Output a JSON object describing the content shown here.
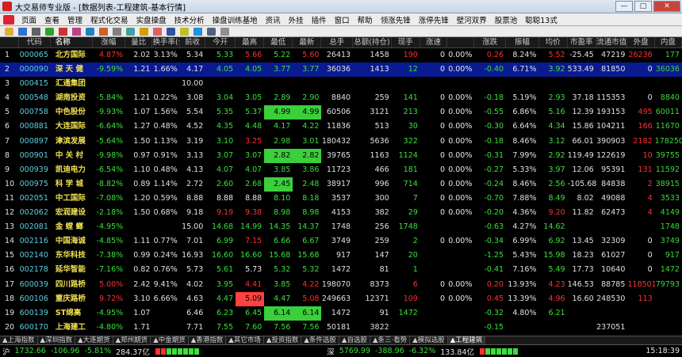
{
  "window": {
    "title": "大交易师专业版 - [数据列表-工程建筑-基本行情]",
    "minimize": "—",
    "maximize": "□",
    "close": "✕"
  },
  "menu": [
    "页面",
    "查看",
    "管理",
    "程式化交易",
    "实盘操盘",
    "技术分析",
    "操盘训练基地",
    "资讯",
    "外挂",
    "插件",
    "窗口",
    "帮助",
    "领涨先锋",
    "涨停先锋",
    "壁河双界",
    "股票池",
    "聪聪13式"
  ],
  "toolbar_icons": [
    "folder-icon",
    "save-icon",
    "print-icon",
    "arrow-up-icon",
    "arrow-down-icon",
    "chart-icon",
    "list-icon",
    "candle-icon",
    "zoom-icon",
    "grid-icon",
    "diamond-icon",
    "star-icon",
    "flag-icon",
    "bell-icon",
    "info-icon",
    "table-icon",
    "tool-icon"
  ],
  "headers": [
    "",
    "代码",
    "名称",
    "涨幅",
    "量比",
    "换手率(仓差)",
    "前收",
    "今开",
    "最高",
    "最低",
    "最新",
    "总手",
    "总额(持仓)",
    "现手",
    "涨速",
    "涨跌",
    "振幅",
    "均价",
    "市盈率",
    "流通市值",
    "外盘",
    "内盘"
  ],
  "rows": [
    {
      "idx": "1",
      "code": "000065",
      "name": "北方国际",
      "pct": "4.87%",
      "liang": "2.02",
      "hsl": "3.13%",
      "prev": "5.34",
      "open": "5.33",
      "high": "5.66",
      "low": "5.22",
      "last": "5.60",
      "total": "26413",
      "hold": "1458",
      "cur": "190",
      "zs": "0",
      "zf": "0.00%",
      "zd": "0.26",
      "zf2": "8.24%",
      "avg": "5.52",
      "pe": "-25.45",
      "flow": "47219",
      "out": "26236",
      "in": "177"
    },
    {
      "idx": "2",
      "code": "000090",
      "name": "深 天 健",
      "pct": "-9.59%",
      "liang": "1.21",
      "hsl": "1.66%",
      "prev": "4.17",
      "open": "4.05",
      "high": "4.05",
      "low": "3.77",
      "last": "3.77",
      "total": "36036",
      "hold": "1413",
      "cur": "12",
      "zs": "0",
      "zf": "0.00%",
      "zd": "-0.40",
      "zf2": "6.71%",
      "avg": "3.92",
      "pe": "533.49",
      "flow": "81850",
      "out": "0",
      "in": "36036"
    },
    {
      "idx": "3",
      "code": "000415",
      "name": "汇通集团",
      "pct": "",
      "liang": "",
      "hsl": "",
      "prev": "10.00",
      "open": "",
      "high": "",
      "low": "",
      "last": "",
      "total": "",
      "hold": "",
      "cur": "",
      "zs": "",
      "zf": "",
      "zd": "",
      "zf2": "",
      "avg": "",
      "pe": "",
      "flow": "",
      "out": "",
      "in": ""
    },
    {
      "idx": "4",
      "code": "000548",
      "name": "湖南投资",
      "pct": "-5.84%",
      "liang": "1.21",
      "hsl": "0.22%",
      "prev": "3.08",
      "open": "3.04",
      "high": "3.05",
      "low": "2.89",
      "last": "2.90",
      "total": "8840",
      "hold": "259",
      "cur": "141",
      "zs": "0",
      "zf": "0.00%",
      "zd": "-0.18",
      "zf2": "5.19%",
      "avg": "2.93",
      "pe": "37.18",
      "flow": "115353",
      "out": "0",
      "in": "8840"
    },
    {
      "idx": "5",
      "code": "000758",
      "name": "中色股份",
      "pct": "-9.93%",
      "liang": "1.07",
      "hsl": "1.56%",
      "prev": "5.54",
      "open": "5.35",
      "high": "5.37",
      "low": "4.99",
      "last": "4.99",
      "total": "60506",
      "hold": "3121",
      "cur": "213",
      "zs": "0",
      "zf": "0.00%",
      "zd": "-0.55",
      "zf2": "6.86%",
      "avg": "5.16",
      "pe": "12.39",
      "flow": "193153",
      "out": "495",
      "in": "60011"
    },
    {
      "idx": "6",
      "code": "000881",
      "name": "大连国际",
      "pct": "-6.64%",
      "liang": "1.27",
      "hsl": "0.48%",
      "prev": "4.52",
      "open": "4.35",
      "high": "4.48",
      "low": "4.17",
      "last": "4.22",
      "total": "11836",
      "hold": "513",
      "cur": "30",
      "zs": "0",
      "zf": "0.00%",
      "zd": "-0.30",
      "zf2": "6.64%",
      "avg": "4.34",
      "pe": "15.86",
      "flow": "104211",
      "out": "166",
      "in": "11670"
    },
    {
      "idx": "7",
      "code": "000897",
      "name": "津滨发展",
      "pct": "-5.64%",
      "liang": "1.50",
      "hsl": "1.13%",
      "prev": "3.19",
      "open": "3.10",
      "high": "3.25",
      "low": "2.98",
      "last": "3.01",
      "total": "180432",
      "hold": "5636",
      "cur": "322",
      "zs": "0",
      "zf": "0.00%",
      "zd": "-0.18",
      "zf2": "8.46%",
      "avg": "3.12",
      "pe": "66.01",
      "flow": "390903",
      "out": "2182",
      "in": "178250"
    },
    {
      "idx": "8",
      "code": "000901",
      "name": "中 关 村",
      "pct": "-9.98%",
      "liang": "0.97",
      "hsl": "0.91%",
      "prev": "3.13",
      "open": "3.07",
      "high": "3.07",
      "low": "2.82",
      "last": "2.82",
      "total": "39765",
      "hold": "1163",
      "cur": "1124",
      "zs": "0",
      "zf": "0.00%",
      "zd": "-0.31",
      "zf2": "7.99%",
      "avg": "2.92",
      "pe": "119.49",
      "flow": "122619",
      "out": "10",
      "in": "39755"
    },
    {
      "idx": "9",
      "code": "000939",
      "name": "凯迪电力",
      "pct": "-6.54%",
      "liang": "1.10",
      "hsl": "0.48%",
      "prev": "4.13",
      "open": "4.07",
      "high": "4.07",
      "low": "3.85",
      "last": "3.86",
      "total": "11723",
      "hold": "466",
      "cur": "181",
      "zs": "0",
      "zf": "0.00%",
      "zd": "-0.27",
      "zf2": "5.33%",
      "avg": "3.97",
      "pe": "12.06",
      "flow": "95391",
      "out": "131",
      "in": "11592"
    },
    {
      "idx": "10",
      "code": "000975",
      "name": "科 学 城",
      "pct": "-8.82%",
      "liang": "0.89",
      "hsl": "1.14%",
      "prev": "2.72",
      "open": "2.60",
      "high": "2.68",
      "low": "2.45",
      "last": "2.48",
      "total": "38917",
      "hold": "996",
      "cur": "714",
      "zs": "0",
      "zf": "0.00%",
      "zd": "-0.24",
      "zf2": "8.46%",
      "avg": "2.56",
      "pe": "-105.68",
      "flow": "84838",
      "out": "2",
      "in": "38915"
    },
    {
      "idx": "11",
      "code": "002051",
      "name": "中工国际",
      "pct": "-7.08%",
      "liang": "1.20",
      "hsl": "0.59%",
      "prev": "8.88",
      "open": "8.88",
      "high": "8.88",
      "low": "8.10",
      "last": "8.18",
      "total": "3537",
      "hold": "300",
      "cur": "7",
      "zs": "0",
      "zf": "0.00%",
      "zd": "-0.70",
      "zf2": "7.88%",
      "avg": "8.49",
      "pe": "8.02",
      "flow": "49088",
      "out": "4",
      "in": "3533"
    },
    {
      "idx": "12",
      "code": "002062",
      "name": "宏润建设",
      "pct": "-2.18%",
      "liang": "1.50",
      "hsl": "0.68%",
      "prev": "9.18",
      "open": "9.19",
      "high": "9.38",
      "low": "8.98",
      "last": "8.98",
      "total": "4153",
      "hold": "382",
      "cur": "29",
      "zs": "0",
      "zf": "0.00%",
      "zd": "-0.20",
      "zf2": "4.36%",
      "avg": "9.20",
      "pe": "11.82",
      "flow": "62473",
      "out": "4",
      "in": "4149"
    },
    {
      "idx": "13",
      "code": "002081",
      "name": "金 螳 螂",
      "pct": "-4.95%",
      "liang": "",
      "hsl": "",
      "prev": "15.00",
      "open": "14.68",
      "high": "14.99",
      "low": "14.35",
      "last": "14.37",
      "total": "1748",
      "hold": "256",
      "cur": "1748",
      "zs": "",
      "zf": "",
      "zd": "-0.63",
      "zf2": "4.27%",
      "avg": "14.62",
      "pe": "",
      "flow": "",
      "out": "",
      "in": "1748"
    },
    {
      "idx": "14",
      "code": "002116",
      "name": "中国海诚",
      "pct": "-4.85%",
      "liang": "1.11",
      "hsl": "0.77%",
      "prev": "7.01",
      "open": "6.99",
      "high": "7.15",
      "low": "6.66",
      "last": "6.67",
      "total": "3749",
      "hold": "259",
      "cur": "2",
      "zs": "0",
      "zf": "0.00%",
      "zd": "-0.34",
      "zf2": "6.99%",
      "avg": "6.92",
      "pe": "13.45",
      "flow": "32309",
      "out": "0",
      "in": "3749"
    },
    {
      "idx": "15",
      "code": "002140",
      "name": "东华科技",
      "pct": "-7.38%",
      "liang": "0.99",
      "hsl": "0.24%",
      "prev": "16.93",
      "open": "16.60",
      "high": "16.60",
      "low": "15.68",
      "last": "15.68",
      "total": "917",
      "hold": "147",
      "cur": "20",
      "zs": "",
      "zf": "",
      "zd": "-1.25",
      "zf2": "5.43%",
      "avg": "15.98",
      "pe": "18.23",
      "flow": "61027",
      "out": "0",
      "in": "917"
    },
    {
      "idx": "16",
      "code": "002178",
      "name": "延华智能",
      "pct": "-7.16%",
      "liang": "0.82",
      "hsl": "0.76%",
      "prev": "5.73",
      "open": "5.61",
      "high": "5.73",
      "low": "5.32",
      "last": "5.32",
      "total": "1472",
      "hold": "81",
      "cur": "1",
      "zs": "",
      "zf": "",
      "zd": "-0.41",
      "zf2": "7.16%",
      "avg": "5.49",
      "pe": "17.73",
      "flow": "10640",
      "out": "0",
      "in": "1472"
    },
    {
      "idx": "17",
      "code": "600039",
      "name": "四川路桥",
      "pct": "5.00%",
      "liang": "2.42",
      "hsl": "9.41%",
      "prev": "4.02",
      "open": "3.95",
      "high": "4.41",
      "low": "3.85",
      "last": "4.22",
      "total": "198070",
      "hold": "8373",
      "cur": "6",
      "zs": "0",
      "zf": "0.00%",
      "zd": "0.20",
      "zf2": "13.93%",
      "avg": "4.23",
      "pe": "146.53",
      "flow": "88785",
      "out": "118501",
      "in": "79793"
    },
    {
      "idx": "18",
      "code": "600106",
      "name": "重庆路桥",
      "pct": "9.72%",
      "liang": "3.10",
      "hsl": "6.66%",
      "prev": "4.63",
      "open": "4.47",
      "high": "5.09",
      "low": "4.47",
      "last": "5.08",
      "total": "249663",
      "hold": "12371",
      "cur": "109",
      "zs": "0",
      "zf": "0.00%",
      "zd": "0.45",
      "zf2": "13.39%",
      "avg": "4.96",
      "pe": "16.60",
      "flow": "248530",
      "out": "113",
      "in": ""
    },
    {
      "idx": "19",
      "code": "600139",
      "name": "ST绵高",
      "pct": "-4.95%",
      "liang": "1.07",
      "hsl": "",
      "prev": "6.46",
      "open": "6.23",
      "high": "6.45",
      "low": "6.14",
      "last": "6.14",
      "total": "1472",
      "hold": "91",
      "cur": "1472",
      "zs": "",
      "zf": "",
      "zd": "-0.32",
      "zf2": "4.80%",
      "avg": "6.21",
      "pe": "",
      "flow": "",
      "out": "",
      "in": ""
    },
    {
      "idx": "20",
      "code": "600170",
      "name": "上海建工",
      "pct": "-4.80%",
      "liang": "1.71",
      "hsl": "",
      "prev": "7.71",
      "open": "7.55",
      "high": "7.60",
      "low": "7.56",
      "last": "7.56",
      "total": "50181",
      "hold": "3822",
      "cur": "",
      "zs": "",
      "zf": "",
      "zd": "-0.15",
      "zf2": "",
      "avg": "",
      "pe": "",
      "flow": "237051",
      "out": "",
      "in": ""
    }
  ],
  "highlights": {
    "5": {
      "low": "g",
      "last": "g"
    },
    "8": {
      "low": "g",
      "last": "g"
    },
    "10": {
      "low": "g"
    },
    "18": {
      "high": "r"
    },
    "19": {
      "low": "g",
      "last": "g"
    }
  },
  "tabs": [
    "上海指数",
    "深圳指数",
    "大连期货",
    "郑州期货",
    "中金期货",
    "香港指数",
    "其它市场",
    "投资指数",
    "条件选股",
    "自选股",
    "条三·看势",
    "模拟选股",
    "工程建筑"
  ],
  "status": {
    "sh_label": "沪",
    "sh_value": "1732.66",
    "sh_change": "-106.96",
    "sh_pct": "-5.81%",
    "sh_amount": "284.37亿",
    "sz_label": "深",
    "sz_value": "5769.99",
    "sz_change": "-388.96",
    "sz_pct": "-6.32%",
    "sz_amount": "133.84亿",
    "time": "15:18:39"
  },
  "colors": {
    "up": "#ff3030",
    "down": "#3ce03c",
    "name": "#f0e050",
    "code": "#5ad0e0",
    "selected": "#0a1a90"
  }
}
